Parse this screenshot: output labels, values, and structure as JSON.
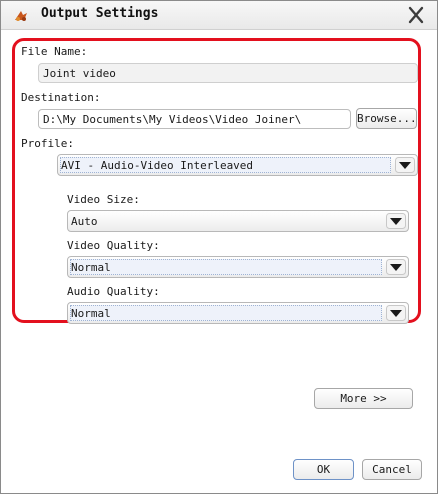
{
  "window": {
    "title": "Output Settings",
    "icons": {
      "app": "app-logo-icon",
      "close": "close-icon"
    }
  },
  "form": {
    "file_name": {
      "label": "File Name:",
      "value": "Joint video"
    },
    "destination": {
      "label": "Destination:",
      "value": "D:\\My Documents\\My Videos\\Video Joiner\\",
      "browse_label": "Browse..."
    },
    "profile": {
      "label": "Profile:",
      "value": "AVI - Audio-Video Interleaved"
    },
    "video_size": {
      "label": "Video Size:",
      "value": "Auto"
    },
    "video_quality": {
      "label": "Video Quality:",
      "value": "Normal"
    },
    "audio_quality": {
      "label": "Audio Quality:",
      "value": "Normal"
    }
  },
  "buttons": {
    "more": "More >>",
    "ok": "OK",
    "cancel": "Cancel"
  },
  "colors": {
    "highlight_frame": "#e3101e",
    "selected_field_bg": "#eef2fa"
  }
}
